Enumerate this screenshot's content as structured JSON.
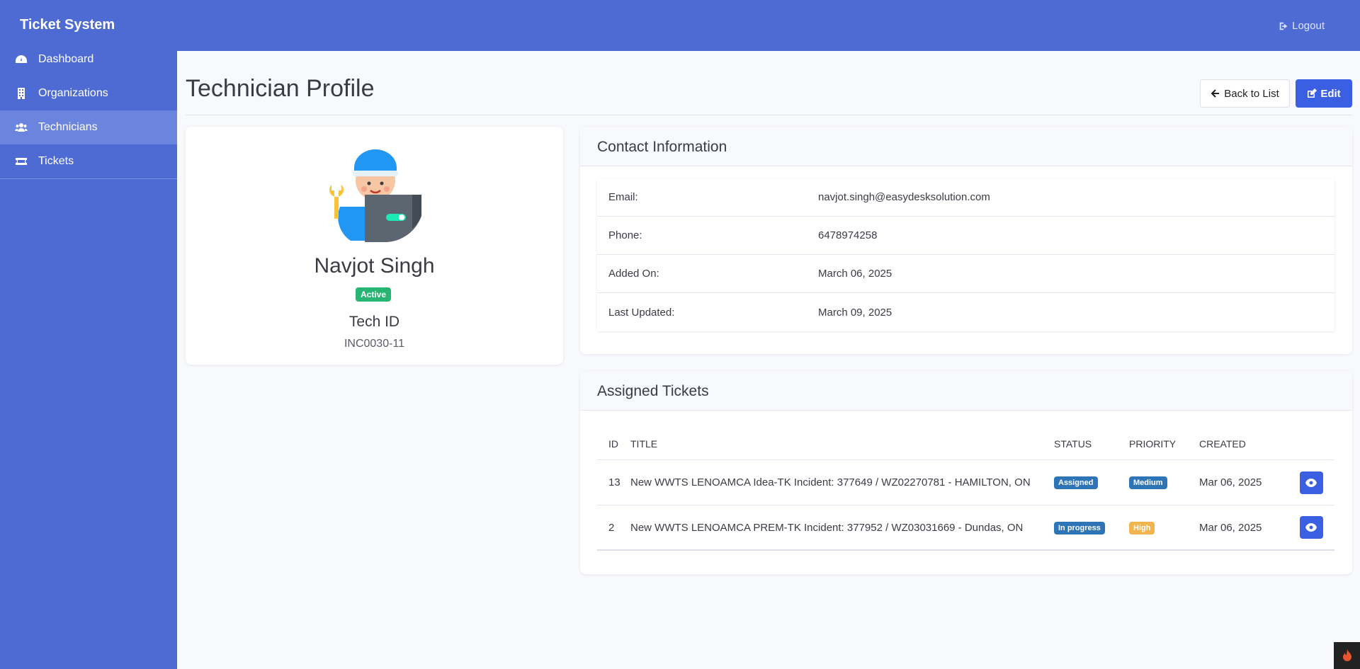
{
  "app": {
    "brand": "Ticket System",
    "logout_label": "Logout"
  },
  "sidebar": {
    "items": [
      {
        "label": "Dashboard",
        "icon": "gauge-icon"
      },
      {
        "label": "Organizations",
        "icon": "building-icon"
      },
      {
        "label": "Technicians",
        "icon": "users-icon",
        "active": true
      },
      {
        "label": "Tickets",
        "icon": "ticket-icon"
      }
    ]
  },
  "header": {
    "title": "Technician Profile",
    "back_label": "Back to List",
    "edit_label": "Edit"
  },
  "profile": {
    "name": "Navjot Singh",
    "status": "Active",
    "tech_id_label": "Tech ID",
    "tech_id": "INC0030-11"
  },
  "contact": {
    "title": "Contact Information",
    "rows": [
      {
        "label": "Email:",
        "value": "navjot.singh@easydesksolution.com"
      },
      {
        "label": "Phone:",
        "value": "6478974258"
      },
      {
        "label": "Added On:",
        "value": "March 06, 2025"
      },
      {
        "label": "Last Updated:",
        "value": "March 09, 2025"
      }
    ]
  },
  "tickets": {
    "title": "Assigned Tickets",
    "columns": [
      "ID",
      "TITLE",
      "STATUS",
      "PRIORITY",
      "CREATED"
    ],
    "rows": [
      {
        "id": "13",
        "title": "New WWTS LENOAMCA Idea-TK Incident: 377649 / WZ02270781 - HAMILTON, ON",
        "status": "Assigned",
        "priority": "Medium",
        "created": "Mar 06, 2025"
      },
      {
        "id": "2",
        "title": "New WWTS LENOAMCA PREM-TK Incident: 377952 / WZ03031669 - Dundas, ON",
        "status": "In progress",
        "priority": "High",
        "created": "Mar 06, 2025"
      }
    ]
  },
  "colors": {
    "primary": "#4e6bd4",
    "button": "#3b5fe3",
    "success": "#28b473",
    "info": "#2e75b8",
    "warning": "#f1b44f"
  }
}
